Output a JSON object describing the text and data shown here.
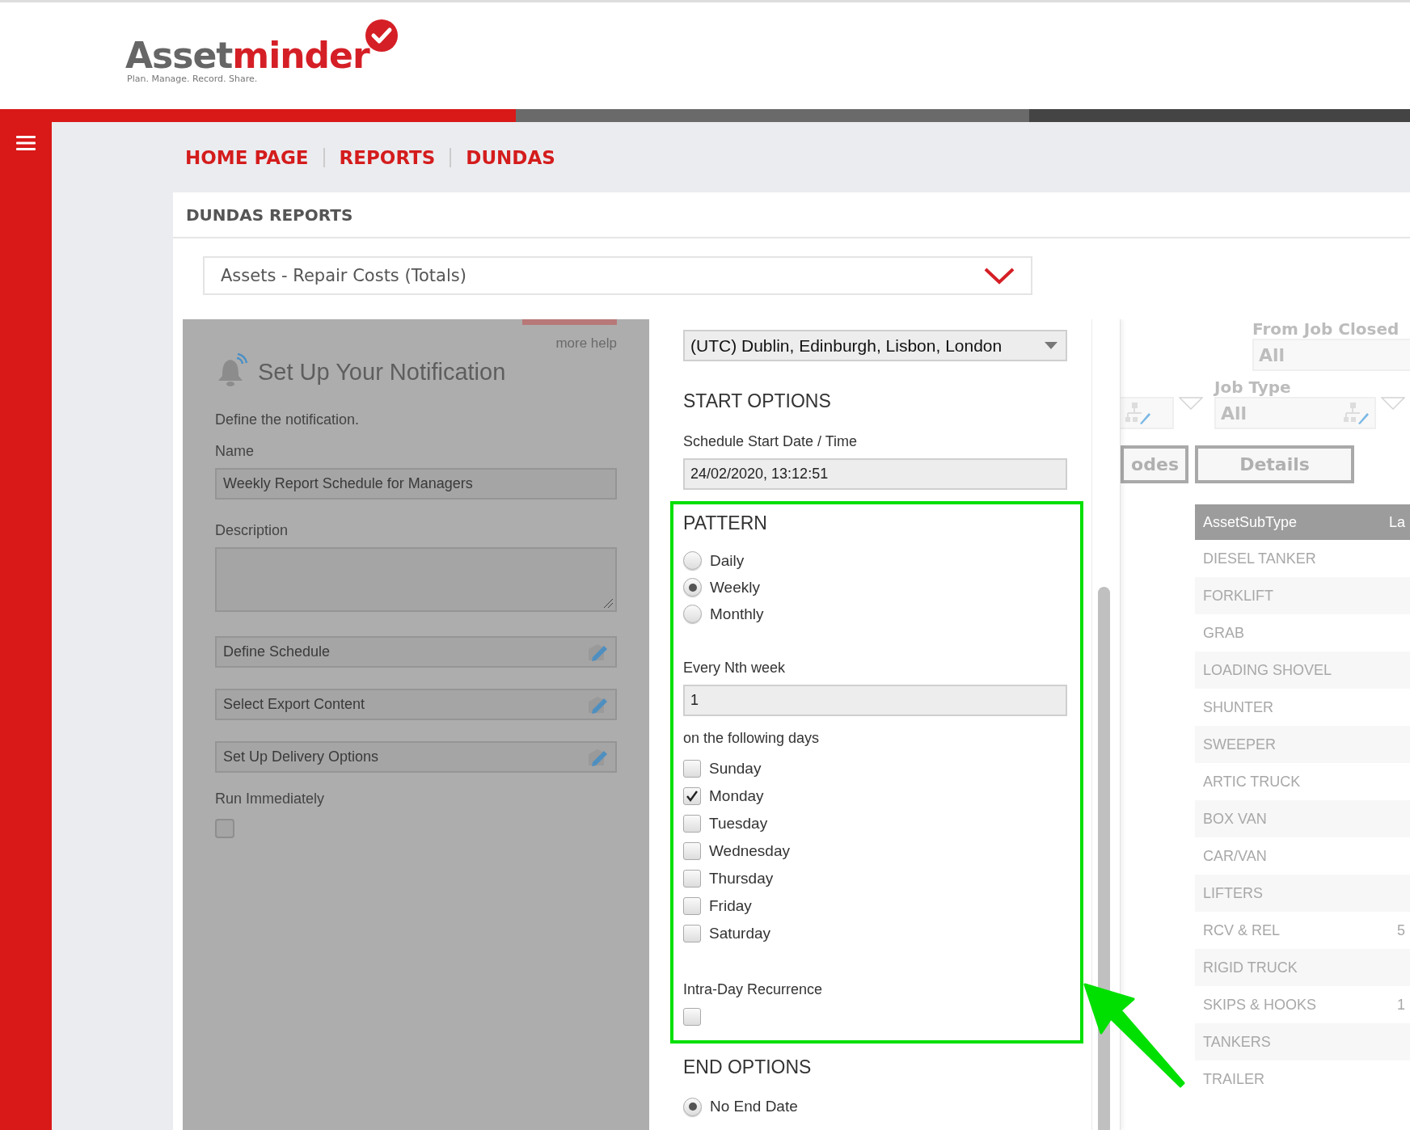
{
  "logo": {
    "brand_first": "Asset",
    "brand_second": "minder",
    "tagline": "Plan. Manage. Record. Share."
  },
  "breadcrumbs": [
    "HOME PAGE",
    "REPORTS",
    "DUNDAS"
  ],
  "panel_title": "DUNDAS REPORTS",
  "report_select": {
    "value": "Assets - Repair Costs (Totals)"
  },
  "notification": {
    "more_help": "more help",
    "title": "Set Up Your Notification",
    "intro": "Define the notification.",
    "name_label": "Name",
    "name_value": "Weekly Report Schedule for Managers",
    "description_label": "Description",
    "steps": [
      "Define Schedule",
      "Select Export Content",
      "Set Up Delivery Options"
    ],
    "run_immediately": {
      "label": "Run Immediately",
      "checked": false
    }
  },
  "schedule": {
    "timezone": "(UTC) Dublin, Edinburgh, Lisbon, London",
    "start_heading": "START OPTIONS",
    "start_label": "Schedule Start Date / Time",
    "start_value": "24/02/2020, 13:12:51",
    "pattern": {
      "heading": "PATTERN",
      "options": [
        {
          "label": "Daily",
          "selected": false
        },
        {
          "label": "Weekly",
          "selected": true
        },
        {
          "label": "Monthly",
          "selected": false
        }
      ],
      "nth_label": "Every Nth week",
      "nth_value": "1",
      "days_label": "on the following days",
      "days": [
        {
          "label": "Sunday",
          "checked": false
        },
        {
          "label": "Monday",
          "checked": true
        },
        {
          "label": "Tuesday",
          "checked": false
        },
        {
          "label": "Wednesday",
          "checked": false
        },
        {
          "label": "Thursday",
          "checked": false
        },
        {
          "label": "Friday",
          "checked": false
        },
        {
          "label": "Saturday",
          "checked": false
        }
      ],
      "intra_day": {
        "label": "Intra-Day Recurrence",
        "checked": false
      }
    },
    "end_heading": "END OPTIONS",
    "end_options": [
      {
        "label": "No End Date",
        "selected": true
      }
    ]
  },
  "report": {
    "filters": [
      {
        "label": "From Job Closed",
        "value": "All"
      },
      {
        "label": "Job Type",
        "value": "All"
      }
    ],
    "buttons": [
      "odes",
      "Details"
    ],
    "table": {
      "columns": [
        "AssetSubType",
        "La"
      ],
      "rows": [
        {
          "name": "DIESEL TANKER"
        },
        {
          "name": "FORKLIFT"
        },
        {
          "name": "GRAB"
        },
        {
          "name": "LOADING SHOVEL"
        },
        {
          "name": "SHUNTER"
        },
        {
          "name": "SWEEPER"
        },
        {
          "name": "ARTIC TRUCK"
        },
        {
          "name": "BOX VAN"
        },
        {
          "name": "CAR/VAN"
        },
        {
          "name": "LIFTERS"
        },
        {
          "name": "RCV & REL",
          "column_2": "5"
        },
        {
          "name": "RIGID TRUCK"
        },
        {
          "name": "SKIPS & HOOKS",
          "column_2": "1"
        },
        {
          "name": "TANKERS"
        },
        {
          "name": "TRAILER"
        }
      ]
    }
  }
}
